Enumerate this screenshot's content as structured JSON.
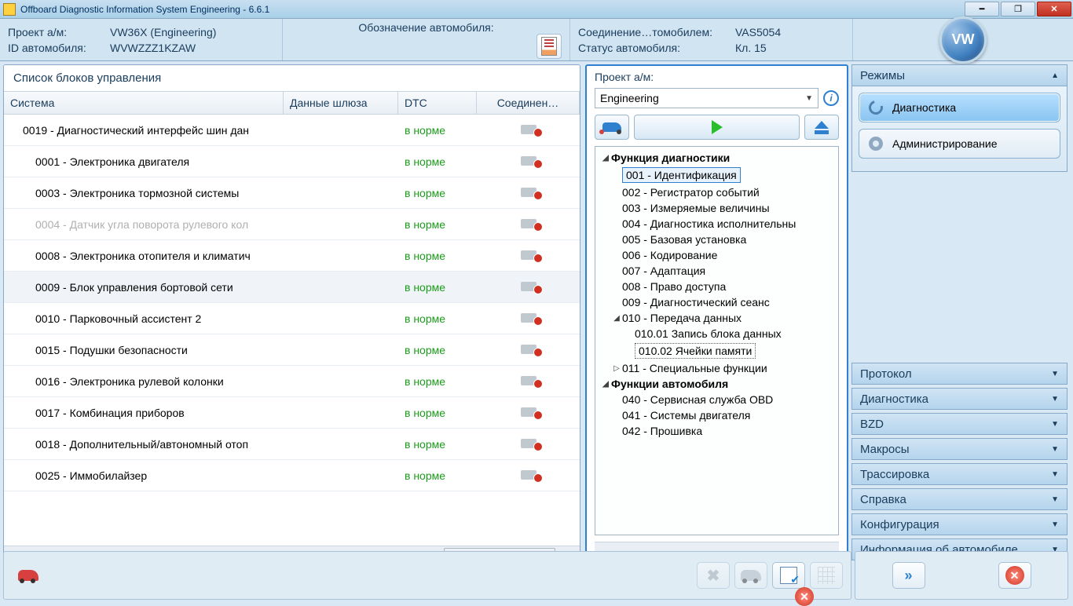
{
  "titlebar": "Offboard Diagnostic Information System Engineering - 6.6.1",
  "info": {
    "project_label": "Проект а/м:",
    "project_value": "VW36X    (Engineering)",
    "id_label": "ID автомобиля:",
    "id_value": "WVWZZZ1KZAW",
    "designation_label": "Обозначение автомобиля:",
    "conn_label": "Соединение…томобилем:",
    "conn_value": "VAS5054",
    "status_label": "Статус автомобиля:",
    "status_value": "Кл. 15"
  },
  "left": {
    "title": "Список блоков управления",
    "headers": {
      "system": "Система",
      "gateway": "Данные шлюза",
      "dtc": "DTC",
      "conn": "Соединен…"
    },
    "rows": [
      {
        "sys": "0019 - Диагностический интерфейс шин дан",
        "dtc": "в норме",
        "first": true
      },
      {
        "sys": "0001 - Электроника двигателя",
        "dtc": "в норме"
      },
      {
        "sys": "0003 - Электроника тормозной системы",
        "dtc": "в норме"
      },
      {
        "sys": "0004 - Датчик угла поворота рулевого кол",
        "dtc": "в норме",
        "disabled": true
      },
      {
        "sys": "0008 - Электроника отопителя и климатич",
        "dtc": "в норме"
      },
      {
        "sys": "0009 - Блок управления бортовой сети",
        "dtc": "в норме",
        "hover": true
      },
      {
        "sys": "0010 - Парковочный ассистент 2",
        "dtc": "в норме"
      },
      {
        "sys": "0015 - Подушки безопасности",
        "dtc": "в норме"
      },
      {
        "sys": "0016 - Электроника рулевой колонки",
        "dtc": "в норме"
      },
      {
        "sys": "0017 - Комбинация приборов",
        "dtc": "в норме"
      },
      {
        "sys": "0018 - Дополнительный/автономный отоп",
        "dtc": "в норме"
      },
      {
        "sys": "0025 - Иммобилайзер",
        "dtc": "в норме"
      }
    ]
  },
  "mid": {
    "label": "Проект а/м:",
    "select_value": "Engineering",
    "tree": [
      {
        "text": "Функция диагностики",
        "bold": true,
        "arrow": "◢",
        "d": 0
      },
      {
        "text": "001 - Идентификация",
        "d": 1,
        "sel": true
      },
      {
        "text": "002 - Регистратор событий",
        "d": 1
      },
      {
        "text": "003 - Измеряемые величины",
        "d": 1
      },
      {
        "text": "004 - Диагностика исполнительны",
        "d": 1
      },
      {
        "text": "005 - Базовая установка",
        "d": 1
      },
      {
        "text": "006 - Кодирование",
        "d": 1
      },
      {
        "text": "007 - Адаптация",
        "d": 1
      },
      {
        "text": "008 - Право доступа",
        "d": 1
      },
      {
        "text": "009 - Диагностический сеанс",
        "d": 1
      },
      {
        "text": "010 - Передача данных",
        "d": 1,
        "arrow": "◢"
      },
      {
        "text": "010.01 Запись блока данных",
        "d": 2
      },
      {
        "text": "010.02 Ячейки памяти",
        "d": 2,
        "cur": true
      },
      {
        "text": "011 - Специальные функции",
        "d": 1,
        "arrow": "▷"
      },
      {
        "text": "Функции автомобиля",
        "bold": true,
        "arrow": "◢",
        "d": 0
      },
      {
        "text": "040 - Сервисная служба OBD",
        "d": 1
      },
      {
        "text": "041 - Системы двигателя",
        "d": 1
      },
      {
        "text": "042 - Прошивка",
        "d": 1
      }
    ]
  },
  "right": {
    "modes_title": "Режимы",
    "diag": "Диагностика",
    "admin": "Администрирование",
    "sections": [
      "Протокол",
      "Диагностика",
      "BZD",
      "Макросы",
      "Трассировка",
      "Справка",
      "Конфигурация",
      "Информация об автомобиле"
    ]
  },
  "vw": "VW"
}
